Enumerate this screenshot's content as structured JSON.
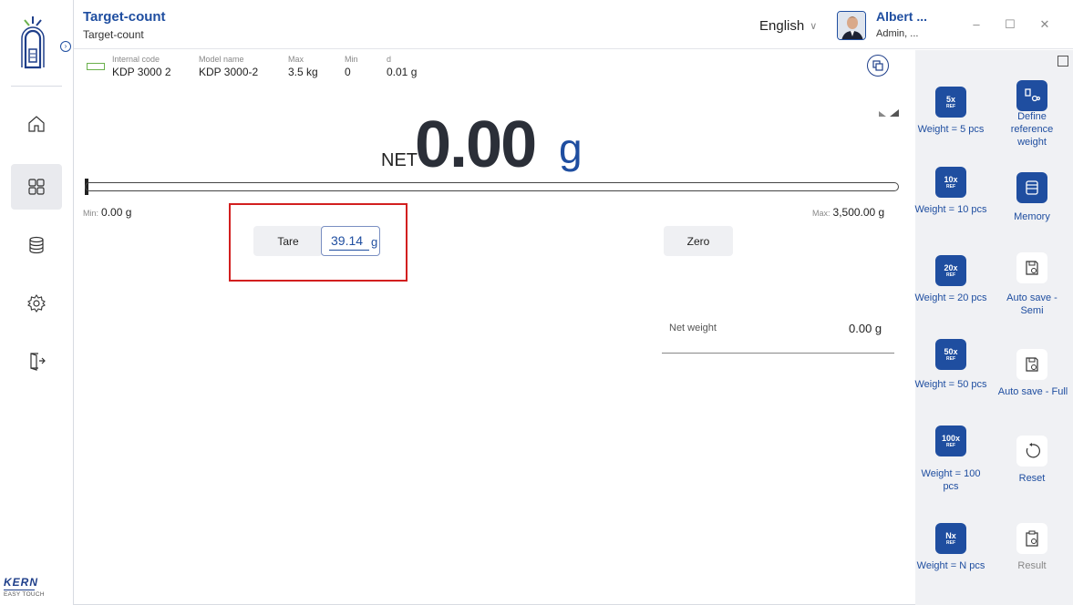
{
  "app": {
    "title": "Target-count",
    "subtitle": "Target-count"
  },
  "language": {
    "selected": "English"
  },
  "user": {
    "name": "Albert ...",
    "role": "Admin, ..."
  },
  "brand": {
    "logo_text": "KERN",
    "tagline": "EASY TOUCH"
  },
  "nav": [
    {
      "name": "home-icon",
      "active": false
    },
    {
      "name": "apps-icon",
      "active": true
    },
    {
      "name": "database-icon",
      "active": false
    },
    {
      "name": "settings-icon",
      "active": false
    },
    {
      "name": "logout-icon",
      "active": false
    }
  ],
  "info": {
    "internal_code_label": "Internal code",
    "internal_code": "KDP 3000 2",
    "model_label": "Model name",
    "model": "KDP 3000-2",
    "max_label": "Max",
    "max": "3.5 kg",
    "min_label": "Min",
    "min": "0",
    "d_label": "d",
    "d": "0.01 g"
  },
  "display": {
    "net_label": "NET",
    "value": "0.00",
    "unit": "g"
  },
  "bargraph": {
    "min_key": "Min:",
    "min_value": "0.00 g",
    "max_key": "Max:",
    "max_value": "3,500.00 g",
    "fill_fraction": 0
  },
  "tare": {
    "label": "Tare",
    "value": "39.14",
    "unit": "g"
  },
  "zero": {
    "label": "Zero"
  },
  "net_weight": {
    "label": "Net weight",
    "value": "0.00 g"
  },
  "right_panel": {
    "ref5": {
      "big": "5x",
      "small": "REF",
      "label": "Weight = 5 pcs"
    },
    "define_ref": {
      "label": "Define reference weight"
    },
    "ref10": {
      "big": "10x",
      "small": "REF",
      "label": "Weight = 10 pcs"
    },
    "memory": {
      "label": "Memory"
    },
    "ref20": {
      "big": "20x",
      "small": "REF",
      "label": "Weight = 20 pcs"
    },
    "auto_semi": {
      "label": "Auto save - Semi"
    },
    "ref50": {
      "big": "50x",
      "small": "REF",
      "label": "Weight = 50 pcs"
    },
    "auto_full": {
      "label": "Auto save - Full"
    },
    "ref100": {
      "big": "100x",
      "small": "REF",
      "label": "Weight = 100 pcs"
    },
    "reset": {
      "label": "Reset"
    },
    "refN": {
      "big": "Nx",
      "small": "REF",
      "label": "Weight = N pcs"
    },
    "result": {
      "label": "Result"
    }
  },
  "colors": {
    "accent": "#1f4ea0",
    "highlight": "#d21f1f",
    "panel": "#f0f1f4"
  }
}
